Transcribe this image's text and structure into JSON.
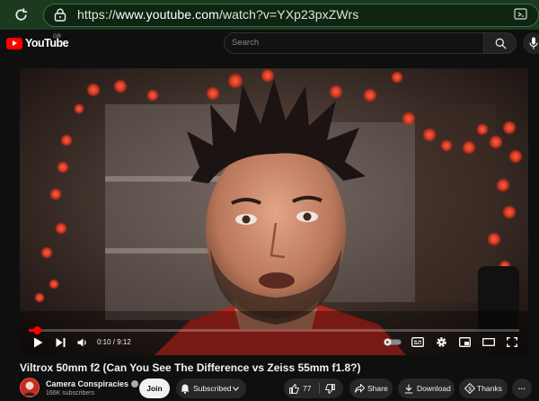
{
  "browser": {
    "url_prefix": "https://",
    "url_host": "www.youtube.com",
    "url_path": "/watch?v=YXp23pxZWrs",
    "accent": "#1c3a20"
  },
  "header": {
    "logo_text": "YouTube",
    "country_code": "GR",
    "search_placeholder": "Search"
  },
  "player": {
    "current_time": "0:10",
    "time_separator": " / ",
    "duration": "9:12",
    "progress_fraction": 0.018,
    "progress_color": "#ff0000"
  },
  "video": {
    "title": "Viltrox 50mm f2 (Can You See The Difference vs Zeiss 55mm f1.8?)"
  },
  "channel": {
    "name": "Camera Conspiracies",
    "subscribers": "166K subscribers"
  },
  "actions": {
    "join_label": "Join",
    "subscribed_label": "Subscribed",
    "like_count": "77",
    "share_label": "Share",
    "download_label": "Download",
    "thanks_label": "Thanks",
    "more_label": "···"
  },
  "icons": [
    "reload-icon",
    "lock-icon",
    "extension-icon",
    "search-icon",
    "mic-icon",
    "play-icon",
    "next-icon",
    "volume-icon",
    "autoplay-toggle",
    "subtitles-icon",
    "settings-icon",
    "miniplayer-icon",
    "theater-icon",
    "fullscreen-icon",
    "bell-icon",
    "chevron-down-icon",
    "thumbs-up-icon",
    "thumbs-down-icon",
    "share-icon",
    "download-icon",
    "thanks-icon",
    "verified-icon"
  ]
}
